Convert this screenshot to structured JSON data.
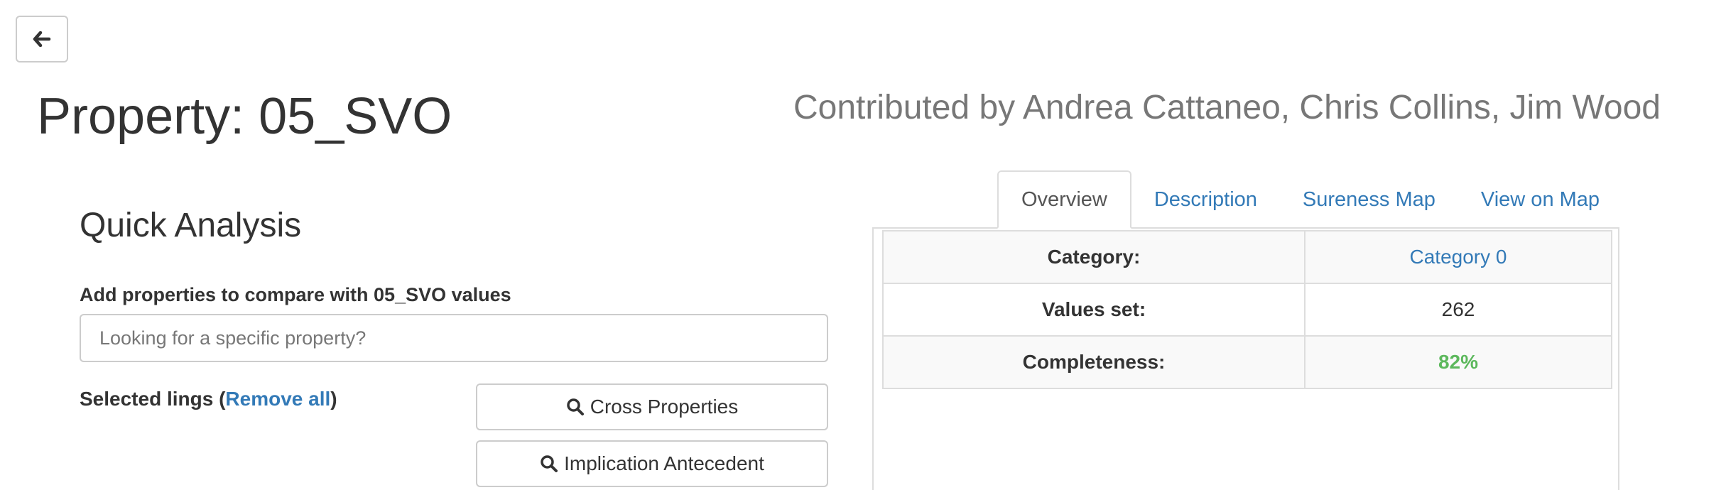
{
  "header": {
    "back_icon": "arrow-left-icon",
    "title": "Property: 05_SVO",
    "contributors": "Contributed by Andrea Cattaneo, Chris Collins, Jim Wood"
  },
  "quick_analysis": {
    "title": "Quick Analysis",
    "compare_label": "Add properties to compare with 05_SVO values",
    "search_placeholder": "Looking for a specific property?",
    "search_value": "",
    "selected_label": "Selected lings (",
    "remove_all_label": "Remove all",
    "selected_label_close": ")",
    "cross_properties_label": "Cross Properties",
    "implication_antecedent_label": "Implication Antecedent",
    "button_icon": "search-icon"
  },
  "tabs": [
    {
      "label": "Overview",
      "active": true
    },
    {
      "label": "Description",
      "active": false
    },
    {
      "label": "Sureness Map",
      "active": false
    },
    {
      "label": "View on Map",
      "active": false
    }
  ],
  "overview": {
    "rows": [
      {
        "label": "Category:",
        "value": "Category 0"
      },
      {
        "label": "Values set:",
        "value": "262"
      },
      {
        "label": "Completeness:",
        "value": "82%"
      }
    ]
  },
  "colors": {
    "link": "#337ab7",
    "success": "#5cb85c",
    "muted": "#777777",
    "border": "#dddddd"
  }
}
